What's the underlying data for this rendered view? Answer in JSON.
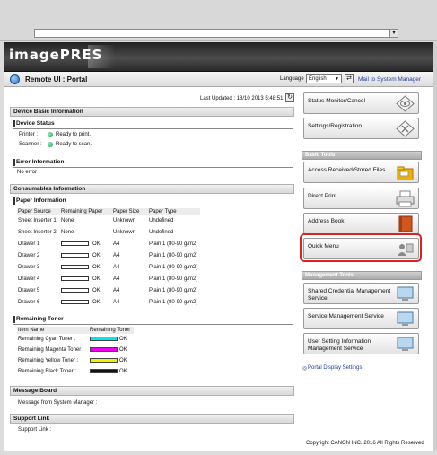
{
  "portal_title": "Remote UI : Portal",
  "language_label": "Language",
  "language_value": "English",
  "mail_link": "Mail to System Manager",
  "last_updated": "Last Updated : 18/10 2013 5:48:51",
  "logo": "imagePRES",
  "sections": {
    "device_basic": "Device Basic Information",
    "consumables": "Consumables Information",
    "message_board": "Message Board",
    "support_link": "Support Link"
  },
  "device_status": {
    "title": "Device Status",
    "printer_label": "Printer :",
    "printer_status": "Ready to print.",
    "scanner_label": "Scanner :",
    "scanner_status": "Ready to scan."
  },
  "error_info": {
    "title": "Error Information",
    "text": "No error"
  },
  "paper_info": {
    "title": "Paper Information",
    "headers": [
      "Paper Source",
      "Remaining Paper",
      "Paper Size",
      "Paper Type"
    ],
    "rows": [
      {
        "source": "Sheet Inserter 1",
        "remaining": "None",
        "size": "Unknown",
        "type": "Undefined"
      },
      {
        "source": "Sheet Inserter 2",
        "remaining": "None",
        "size": "Unknown",
        "type": "Undefined"
      },
      {
        "source": "Drawer 1",
        "remaining": "OK",
        "size": "A4",
        "type": "Plain 1 (80-90 g/m2)"
      },
      {
        "source": "Drawer 2",
        "remaining": "OK",
        "size": "A4",
        "type": "Plain 1 (80-90 g/m2)"
      },
      {
        "source": "Drawer 3",
        "remaining": "OK",
        "size": "A4",
        "type": "Plain 1 (80-90 g/m2)"
      },
      {
        "source": "Drawer 4",
        "remaining": "OK",
        "size": "A4",
        "type": "Plain 1 (80-90 g/m2)"
      },
      {
        "source": "Drawer 5",
        "remaining": "OK",
        "size": "A4",
        "type": "Plain 1 (80-90 g/m2)"
      },
      {
        "source": "Drawer 6",
        "remaining": "OK",
        "size": "A4",
        "type": "Plain 1 (80-90 g/m2)"
      }
    ]
  },
  "toner": {
    "title": "Remaining Toner",
    "headers": [
      "Item Name",
      "Remaining Toner"
    ],
    "rows": [
      {
        "name": "Remaining Cyan Toner :",
        "status": "OK",
        "color": "#00e5ee"
      },
      {
        "name": "Remaining Magenta Toner :",
        "status": "OK",
        "color": "#ee00ee"
      },
      {
        "name": "Remaining Yellow Toner :",
        "status": "OK",
        "color": "#f2f200"
      },
      {
        "name": "Remaining Black Toner :",
        "status": "OK",
        "color": "#111111"
      }
    ]
  },
  "message_board_text": "Message from System Manager :",
  "support_link_text": "Support Link :",
  "right": {
    "status_monitor": "Status Monitor/Cancel",
    "settings": "Settings/Registration",
    "basic_tools_header": "Basic Tools",
    "access_files": "Access Received/Stored Files",
    "direct_print": "Direct Print",
    "address_book": "Address Book",
    "quick_menu": "Quick Menu",
    "mgmt_header": "Management Tools",
    "shared_cred_1": "Shared Credential Management",
    "shared_cred_2": "Service",
    "service_mgmt": "Service Management Service",
    "user_setting_1": "User Setting Information",
    "user_setting_2": "Management Service",
    "portal_display": "Portal Display Settings"
  },
  "copyright": "Copyright CANON INC. 2016 All Rights Reserved"
}
